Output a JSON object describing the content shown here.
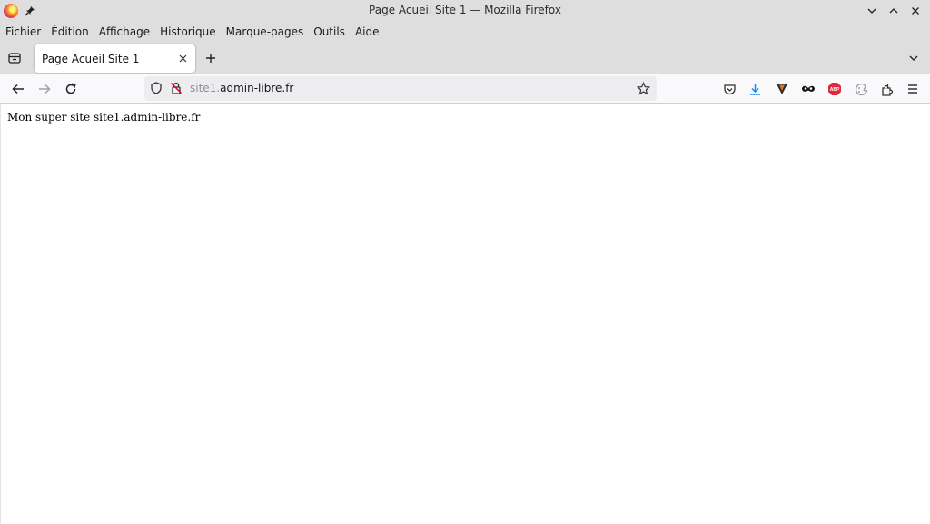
{
  "window": {
    "title": "Page Acueil Site 1 — Mozilla Firefox",
    "controls": [
      "chevron-down",
      "chevron-up",
      "close"
    ]
  },
  "menu": {
    "items": [
      "Fichier",
      "Édition",
      "Affichage",
      "Historique",
      "Marque-pages",
      "Outils",
      "Aide"
    ]
  },
  "tabs": [
    {
      "title": "Page Acueil Site 1",
      "active": true
    }
  ],
  "navigation": {
    "url_prefix": "site1.",
    "url_domain": "admin-libre.fr",
    "toolbar_icons": [
      "pocket-icon",
      "downloads-icon",
      "vpn-extension-icon",
      "mask-extension-icon",
      "adblock-icon",
      "color-extension-icon",
      "extensions-icon",
      "menu-icon"
    ]
  },
  "extensions": {
    "adblock_label": "ABP"
  },
  "content": {
    "text": "Mon super site site1.admin-libre.fr"
  },
  "colors": {
    "chrome": "#dedede",
    "toolbar": "#f9f9fb",
    "urlbar": "#ededf0",
    "download_accent": "#0a84ff",
    "adblock": "#e22a3d"
  }
}
